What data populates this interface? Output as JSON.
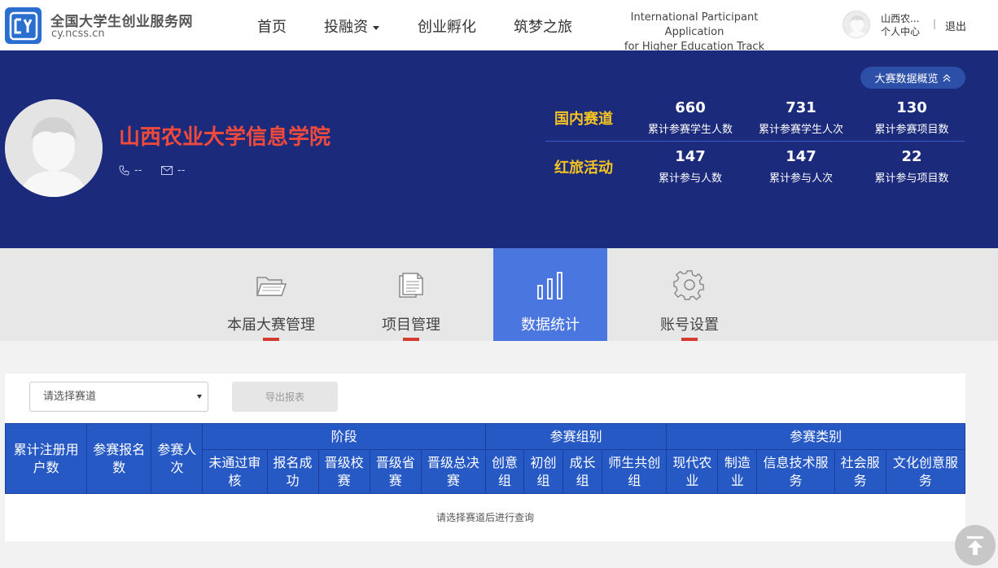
{
  "brand": {
    "title": "全国大学生创业服务网",
    "subtitle": "cy.ncss.cn",
    "logo_icon": "cy-logo-icon",
    "color": "#2a6fd0"
  },
  "nav": {
    "home": "首页",
    "investment": "投融资",
    "incubation": "创业孵化",
    "dream": "筑梦之旅",
    "intl_line1": "International Participant Application",
    "intl_line2": "for Higher Education Track"
  },
  "user": {
    "name": "山西农...",
    "center": "个人中心",
    "separator": "|",
    "logout": "退出"
  },
  "profile": {
    "school_name": "山西农业大学信息学院",
    "phone": "--",
    "email": "--",
    "overview_button": "大赛数据概览"
  },
  "stats": {
    "domestic": {
      "title": "国内赛道",
      "items": [
        {
          "value": "660",
          "label": "累计参赛学生人数"
        },
        {
          "value": "731",
          "label": "累计参赛学生人次"
        },
        {
          "value": "130",
          "label": "累计参赛项目数"
        }
      ]
    },
    "redtour": {
      "title": "红旅活动",
      "items": [
        {
          "value": "147",
          "label": "累计参与人数"
        },
        {
          "value": "147",
          "label": "累计参与人次"
        },
        {
          "value": "22",
          "label": "累计参与项目数"
        }
      ]
    }
  },
  "tabs": [
    {
      "label": "本届大赛管理",
      "icon": "folder-icon"
    },
    {
      "label": "项目管理",
      "icon": "document-icon"
    },
    {
      "label": "数据统计",
      "icon": "bar-chart-icon"
    },
    {
      "label": "账号设置",
      "icon": "gear-icon"
    }
  ],
  "filters": {
    "select_placeholder": "请选择赛道",
    "export_label": "导出报表"
  },
  "table": {
    "col_registered": "累计注册用户数",
    "col_signups": "参赛报名数",
    "col_participants": "参赛人次",
    "group_stage": "阶段",
    "group_team": "参赛组别",
    "group_category": "参赛类别",
    "stage": [
      "未通过审核",
      "报名成功",
      "晋级校赛",
      "晋级省赛",
      "晋级总决赛"
    ],
    "team": [
      "创意组",
      "初创组",
      "成长组",
      "师生共创组"
    ],
    "category": [
      "现代农业",
      "制造业",
      "信息技术服务",
      "社会服务",
      "文化创意服务"
    ],
    "empty_message": "请选择赛道后进行查询"
  },
  "colors": {
    "banner": "#1b2a7a",
    "school_name": "#f04a3c",
    "stat_title": "#f5c322",
    "active_tab": "#4a76e0",
    "table_header": "#2659c4",
    "underline": "#d43a2f"
  }
}
